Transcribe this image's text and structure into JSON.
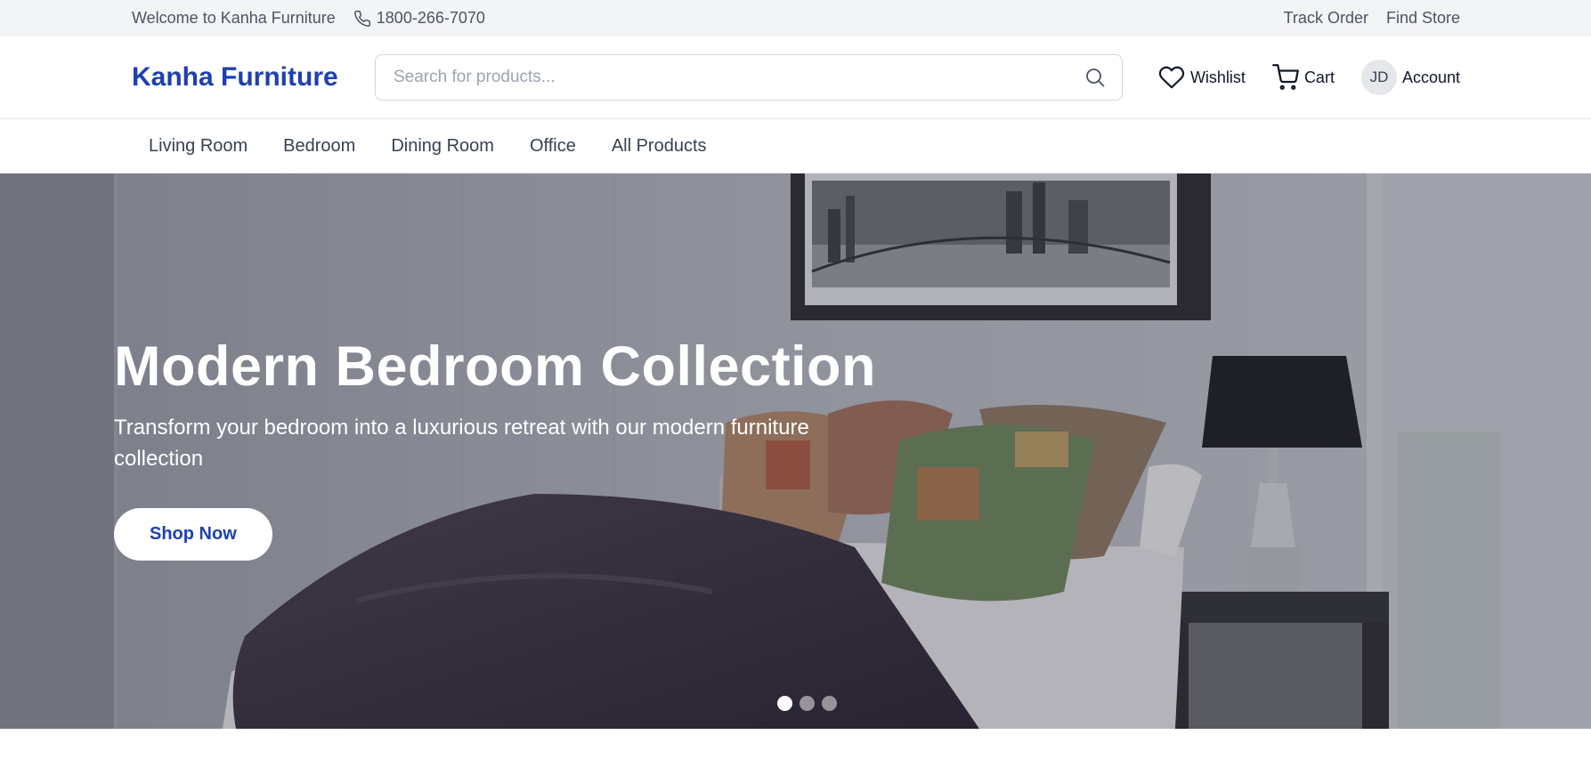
{
  "topbar": {
    "welcome": "Welcome to Kanha Furniture",
    "phone": "1800-266-7070",
    "track_order": "Track Order",
    "find_store": "Find Store"
  },
  "header": {
    "logo": "Kanha Furniture",
    "search_placeholder": "Search for products...",
    "wishlist": "Wishlist",
    "cart": "Cart",
    "avatar_initials": "JD",
    "account": "Account"
  },
  "nav": {
    "items": [
      {
        "label": "Living Room"
      },
      {
        "label": "Bedroom"
      },
      {
        "label": "Dining Room"
      },
      {
        "label": "Office"
      },
      {
        "label": "All Products"
      }
    ]
  },
  "hero": {
    "title": "Modern Bedroom Collection",
    "subtitle": "Transform your bedroom into a luxurious retreat with our modern furniture collection",
    "cta": "Shop Now",
    "slide_count": 3,
    "active_slide": 1
  },
  "colors": {
    "brand": "#1e40af",
    "topbar_bg": "#f3f4f6"
  }
}
